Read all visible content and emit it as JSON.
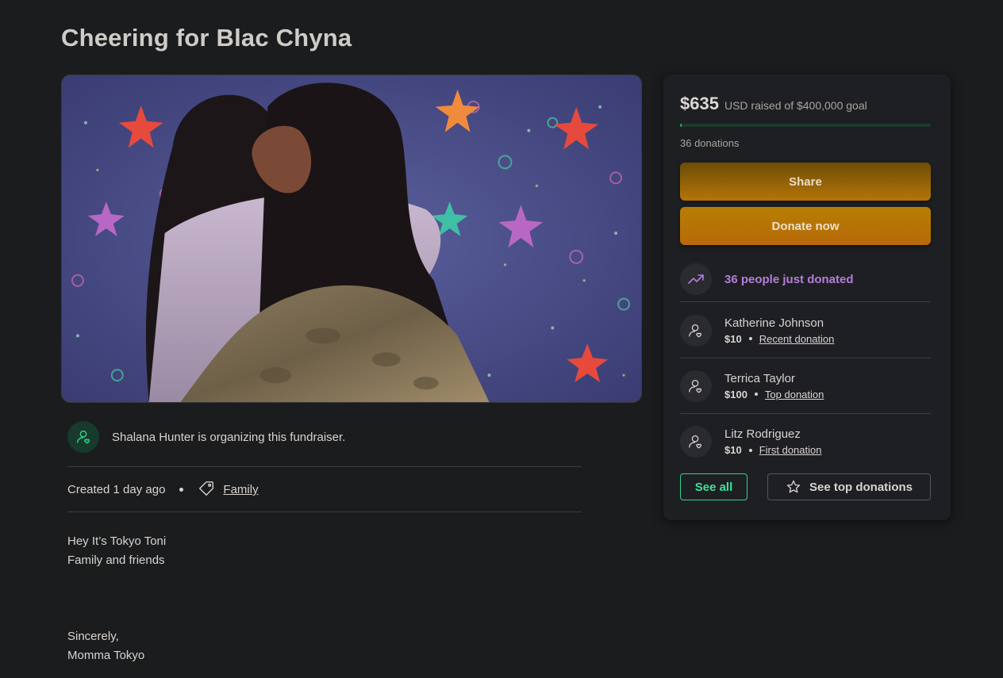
{
  "page": {
    "title": "Cheering for Blac Chyna"
  },
  "organizer": {
    "text": "Shalana Hunter is organizing this fundraiser.",
    "icon": "person-heart-icon"
  },
  "meta": {
    "created": "Created 1 day ago",
    "category": "Family",
    "category_icon": "tag-icon"
  },
  "story": {
    "lines_top": [
      "Hey It’s Tokyo Toni",
      "Family and friends"
    ],
    "lines_bottom": [
      "Sincerely,",
      "Momma Tokyo"
    ]
  },
  "donation_card": {
    "amount": "$635",
    "goal_text": "USD raised of $400,000 goal",
    "progress_fraction": 0.0016,
    "donation_count": "36 donations",
    "share_label": "Share",
    "donate_label": "Donate now",
    "trend_text": "36 people just donated",
    "trend_icon": "trending-up-icon",
    "donors": [
      {
        "name": "Katherine Johnson",
        "amount": "$10",
        "tag": "Recent donation"
      },
      {
        "name": "Terrica Taylor",
        "amount": "$100",
        "tag": "Top donation"
      },
      {
        "name": "Litz Rodriguez",
        "amount": "$10",
        "tag": "First donation"
      }
    ],
    "see_all_label": "See all",
    "see_top_label": "See top donations"
  },
  "colors": {
    "accent_green": "#2fd38a",
    "accent_purple": "#b47ddc",
    "button_gold": "#b57408"
  }
}
